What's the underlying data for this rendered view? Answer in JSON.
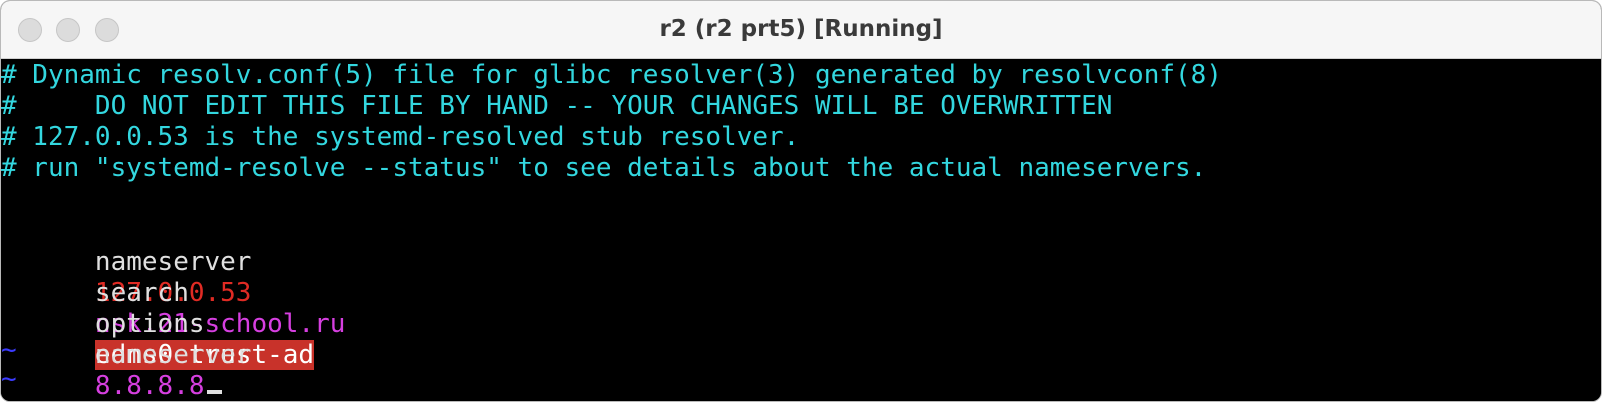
{
  "window": {
    "title": "r2 (r2 prt5) [Running]"
  },
  "terminal": {
    "comment_lines": [
      "# Dynamic resolv.conf(5) file for glibc resolver(3) generated by resolvconf(8)",
      "#     DO NOT EDIT THIS FILE BY HAND -- YOUR CHANGES WILL BE OVERWRITTEN",
      "# 127.0.0.53 is the systemd-resolved stub resolver.",
      "# run \"systemd-resolve --status\" to see details about the actual nameservers."
    ],
    "entries": [
      {
        "keyword": "nameserver",
        "value": "127.0.0.53"
      },
      {
        "keyword": "search",
        "value": "nsk.21-school.ru"
      },
      {
        "keyword": "options",
        "value": "edns0 trust-ad"
      },
      {
        "keyword": "nameserver",
        "value": "8.8.8.8"
      }
    ],
    "empty_line_marker": "~"
  },
  "colors": {
    "comment": "#33d7df",
    "keyword": "#e0e0e0",
    "ip_local": "#e02b24",
    "value_magenta": "#d63fe0",
    "highlight_bg": "#c8322a",
    "tilde": "#3b3bff"
  },
  "icons": [
    "close-button",
    "minimize-button",
    "zoom-button"
  ]
}
